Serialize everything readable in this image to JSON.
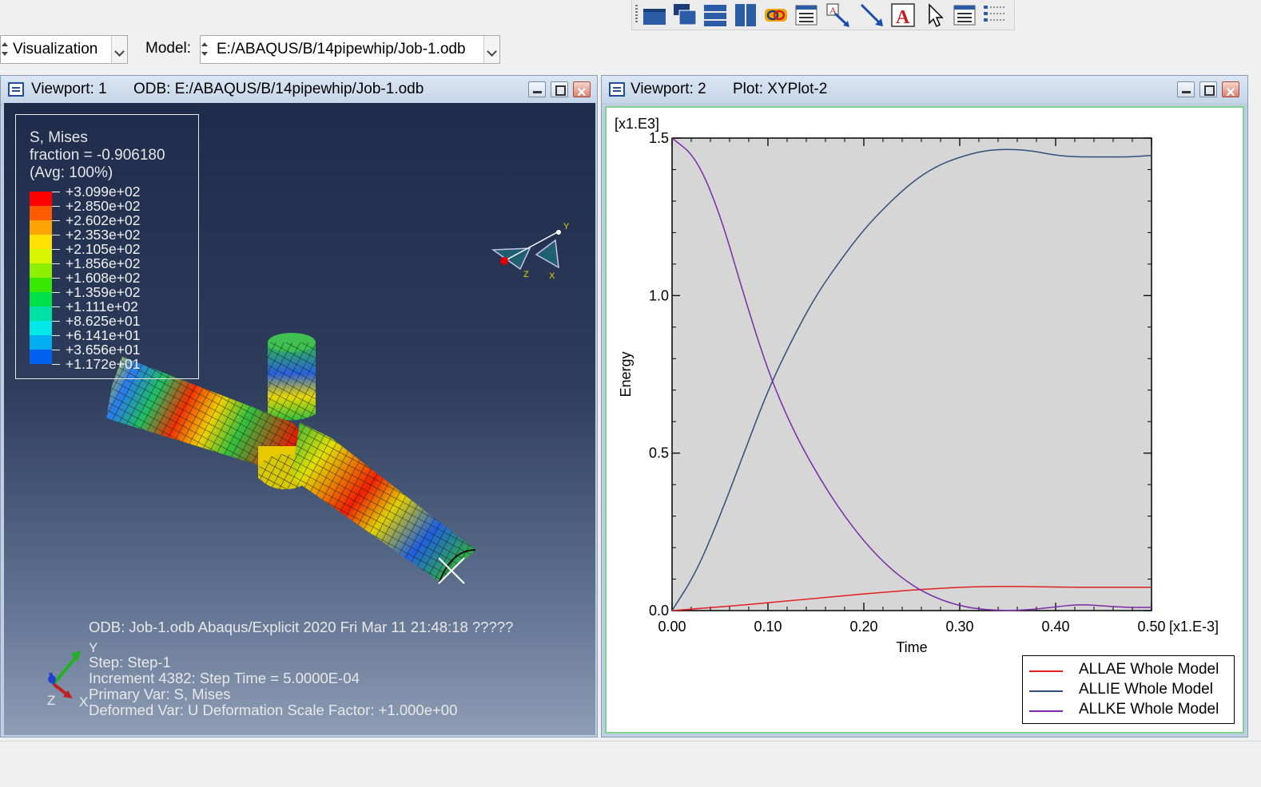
{
  "toolbar": {
    "icons": [
      "tile-viewport-icon",
      "cascade-viewports-icon",
      "tile-horizontal-icon",
      "tile-vertical-icon",
      "link-viewports-icon",
      "viewport-annotation-icon",
      "text-arrow-icon",
      "arrow-icon",
      "text-annotation-icon",
      "select-pointer-icon",
      "legend-options-icon",
      "list-options-icon"
    ]
  },
  "module_bar": {
    "module_value": "Visualization",
    "model_label": "Model:",
    "model_value": "E:/ABAQUS/B/14pipewhip/Job-1.odb"
  },
  "viewport1": {
    "name": "Viewport: 1",
    "odb": "ODB: E:/ABAQUS/B/14pipewhip/Job-1.odb",
    "legend": {
      "title": "S, Mises",
      "fraction": "fraction = -0.906180",
      "avg": "(Avg: 100%)",
      "levels": [
        "+3.099e+02",
        "+2.850e+02",
        "+2.602e+02",
        "+2.353e+02",
        "+2.105e+02",
        "+1.856e+02",
        "+1.608e+02",
        "+1.359e+02",
        "+1.111e+02",
        "+8.625e+01",
        "+6.141e+01",
        "+3.656e+01",
        "+1.172e+01"
      ],
      "colors": [
        "#ff0000",
        "#ff5a00",
        "#ffa300",
        "#ffe000",
        "#d8f500",
        "#8cf000",
        "#37e800",
        "#00e04a",
        "#00e0a6",
        "#00e8e8",
        "#00aef0",
        "#0060f0",
        "#0000e8"
      ]
    },
    "info": {
      "line1": "ODB: Job-1.odb    Abaqus/Explicit 2020    Fri Mar 11 21:48:18 ?????",
      "step": "Step: Step-1",
      "increment": "Increment      4382: Step Time =    5.0000E-04",
      "primary": "Primary Var: S, Mises",
      "deformed": "Deformed Var: U   Deformation Scale Factor: +1.000e+00"
    },
    "triad": {
      "y": "Y",
      "z": "Z",
      "x": "X"
    }
  },
  "viewport2": {
    "name": "Viewport: 2",
    "plot": "Plot: XYPlot-2"
  },
  "chart_data": {
    "type": "line",
    "title": "",
    "xlabel": "Time",
    "ylabel": "Energy",
    "x_multiplier": "[x1.E-3]",
    "y_multiplier": "[x1.E3]",
    "xlim": [
      0.0,
      0.5
    ],
    "ylim": [
      0.0,
      1.5
    ],
    "x_ticks": [
      "0.00",
      "0.10",
      "0.20",
      "0.30",
      "0.40",
      "0.50"
    ],
    "y_ticks": [
      "0.0",
      "0.5",
      "1.0",
      "1.5"
    ],
    "grid": false,
    "legend_position": "bottom-right",
    "x": [
      0.0,
      0.025,
      0.05,
      0.075,
      0.1,
      0.125,
      0.15,
      0.175,
      0.2,
      0.225,
      0.25,
      0.275,
      0.3,
      0.325,
      0.35,
      0.375,
      0.4,
      0.425,
      0.45,
      0.475,
      0.5
    ],
    "series": [
      {
        "name": "ALLAE Whole Model",
        "color": "#e02020",
        "values": [
          0.0,
          0.006,
          0.012,
          0.018,
          0.025,
          0.032,
          0.039,
          0.046,
          0.053,
          0.059,
          0.065,
          0.07,
          0.074,
          0.076,
          0.077,
          0.076,
          0.075,
          0.074,
          0.074,
          0.074,
          0.074
        ]
      },
      {
        "name": "ALLIE Whole Model",
        "color": "#2e4f7a",
        "values": [
          0.0,
          0.12,
          0.3,
          0.5,
          0.7,
          0.86,
          1.0,
          1.11,
          1.21,
          1.29,
          1.36,
          1.41,
          1.44,
          1.46,
          1.465,
          1.46,
          1.445,
          1.44,
          1.44,
          1.44,
          1.445
        ]
      },
      {
        "name": "ALLKE Whole Model",
        "color": "#7a2aa6",
        "values": [
          1.5,
          1.44,
          1.26,
          1.0,
          0.76,
          0.58,
          0.44,
          0.32,
          0.22,
          0.14,
          0.08,
          0.04,
          0.015,
          0.003,
          0.0,
          0.003,
          0.012,
          0.02,
          0.015,
          0.01,
          0.01
        ]
      }
    ]
  }
}
